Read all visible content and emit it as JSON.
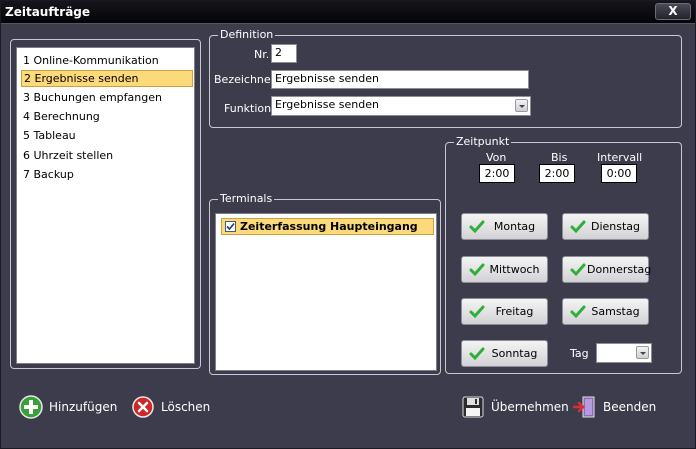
{
  "window": {
    "title": "Zeitaufträge",
    "close_label": "X"
  },
  "jobs": {
    "items": [
      "1 Online-Kommunikation",
      "2 Ergebnisse senden",
      "3 Buchungen empfangen",
      "4 Berechnung",
      "5 Tableau",
      "6 Uhrzeit stellen",
      "7 Backup"
    ],
    "selected_index": 1
  },
  "definition": {
    "legend": "Definition",
    "nr_label": "Nr.",
    "nr_value": "2",
    "bezeichner_label": "Bezeichner",
    "bezeichner_value": "Ergebnisse senden",
    "funktion_label": "Funktion",
    "funktion_value": "Ergebnisse senden"
  },
  "terminals": {
    "legend": "Terminals",
    "items": [
      {
        "label": "Zeiterfassung Haupteingang",
        "checked": true
      }
    ]
  },
  "zeitpunkt": {
    "legend": "Zeitpunkt",
    "von_label": "Von",
    "von_value": "2:00",
    "bis_label": "Bis",
    "bis_value": "2:00",
    "intervall_label": "Intervall",
    "intervall_value": "0:00",
    "days": [
      "Montag",
      "Dienstag",
      "Mittwoch",
      "Donnerstag",
      "Freitag",
      "Samstag",
      "Sonntag"
    ],
    "tag_label": "Tag",
    "tag_value": ""
  },
  "actions": {
    "add": "Hinzufügen",
    "delete": "Löschen",
    "apply": "Übernehmen",
    "exit": "Beenden"
  },
  "colors": {
    "window_bg": "#3c3c4c",
    "selection": "#fcd97a",
    "check_green": "#2fae3a"
  }
}
